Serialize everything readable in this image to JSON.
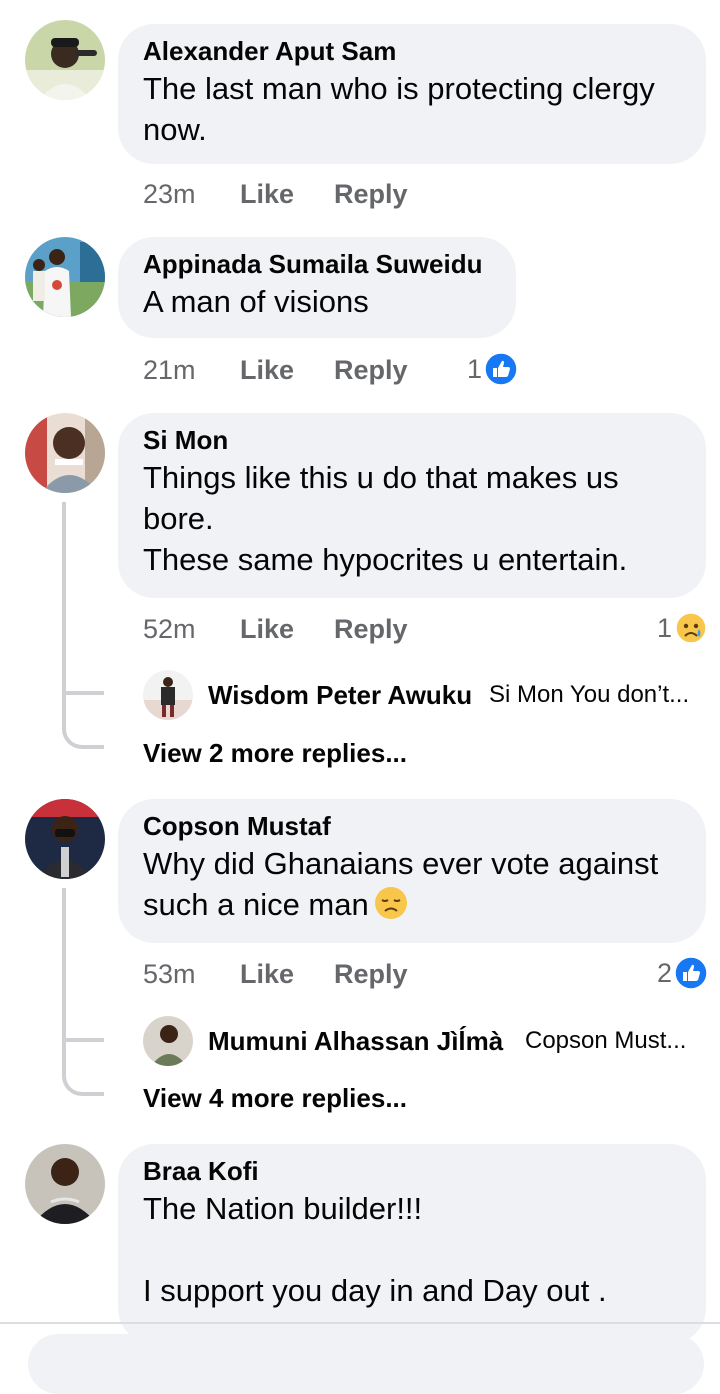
{
  "colors": {
    "bubble_bg": "#f0f2f5",
    "meta_text": "#65676b",
    "like_blue": "#1877f2",
    "thread_line": "#ced0d4"
  },
  "comments": [
    {
      "author": "Alexander Aput Sam",
      "lines": [
        "The last man who is protecting clergy",
        "now."
      ],
      "time": "23m",
      "like_label": "Like",
      "reply_label": "Reply"
    },
    {
      "author": "Appinada Sumaila Suweidu",
      "lines": [
        "A man of visions"
      ],
      "time": "21m",
      "like_label": "Like",
      "reply_label": "Reply",
      "reaction_count": "1",
      "reaction_icon": "like-reaction-icon"
    },
    {
      "author": "Si Mon",
      "lines": [
        "Things like this u do that makes us",
        "bore.",
        "These same hypocrites u entertain."
      ],
      "time": "52m",
      "like_label": "Like",
      "reply_label": "Reply",
      "reaction_count": "1",
      "reaction_icon": "sad-reaction-icon",
      "reply_preview": {
        "author": "Wisdom Peter Awuku",
        "text": "Si Mon You don’t..."
      },
      "view_more": "View 2 more replies..."
    },
    {
      "author": "Copson Mustaf",
      "lines": [
        "Why did Ghanaians ever vote against",
        "such a nice man"
      ],
      "emoji": "disappointed-face-icon",
      "time": "53m",
      "like_label": "Like",
      "reply_label": "Reply",
      "reaction_count": "2",
      "reaction_icon": "like-reaction-icon",
      "reply_preview": {
        "author": "Mumuni Alhassan Jìĺmà",
        "text": "Copson Must..."
      },
      "view_more": "View 4 more replies..."
    },
    {
      "author": "Braa Kofi",
      "lines": [
        "The Nation builder!!!",
        "",
        "I support you day in and Day out ."
      ]
    }
  ]
}
